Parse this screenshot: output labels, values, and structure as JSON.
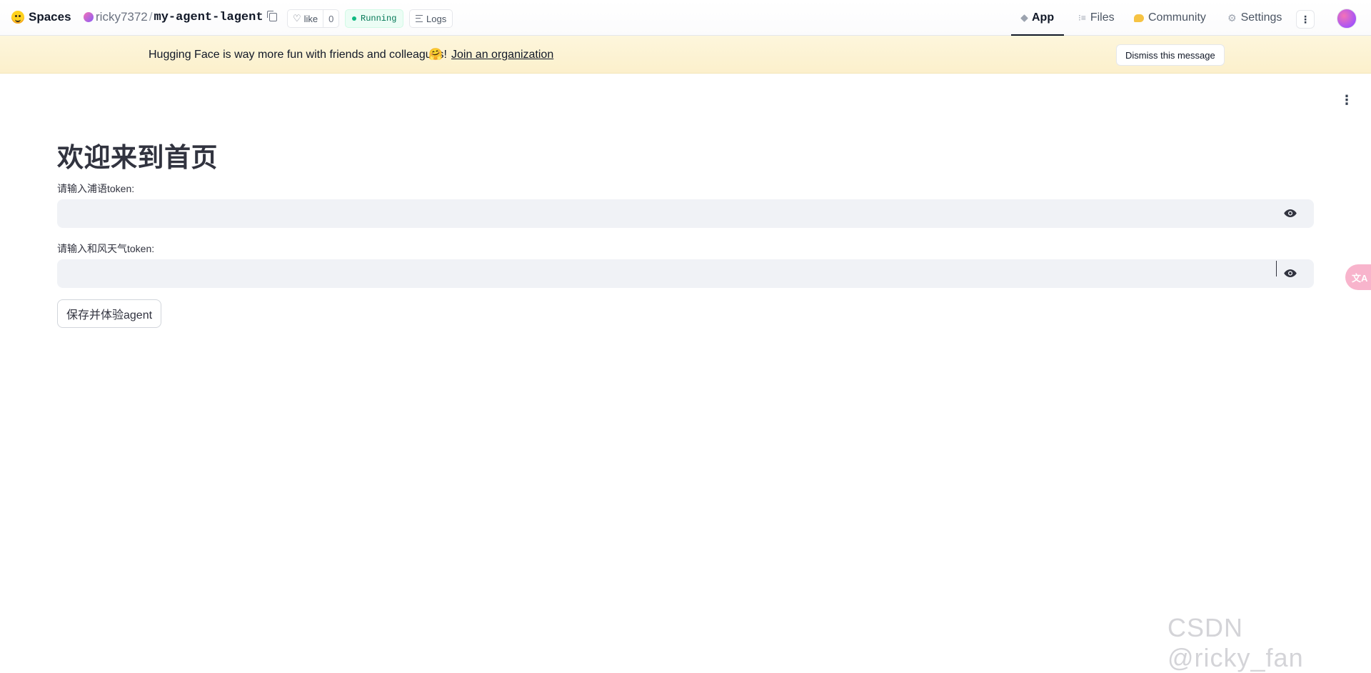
{
  "header": {
    "brand": "Spaces",
    "owner": "ricky7372",
    "separator": "/",
    "space_name": "my-agent-lagent",
    "like_label": "like",
    "like_count": "0",
    "status": "Running",
    "logs_label": "Logs",
    "nav": {
      "app": "App",
      "files": "Files",
      "community": "Community",
      "settings": "Settings"
    },
    "status_color": "#10b981"
  },
  "banner": {
    "message": "Hugging Face is way more fun with friends and colleagues!",
    "emoji": "🤗",
    "join_link": "Join an organization",
    "dismiss": "Dismiss this message"
  },
  "main": {
    "title": "欢迎来到首页",
    "field1_label": "请输入浦语token:",
    "field1_value": "",
    "field2_label": "请输入和风天气token:",
    "field2_value": "",
    "save_button": "保存并体验agent"
  },
  "watermark": "CSDN @ricky_fan",
  "translate_fab": "文A"
}
